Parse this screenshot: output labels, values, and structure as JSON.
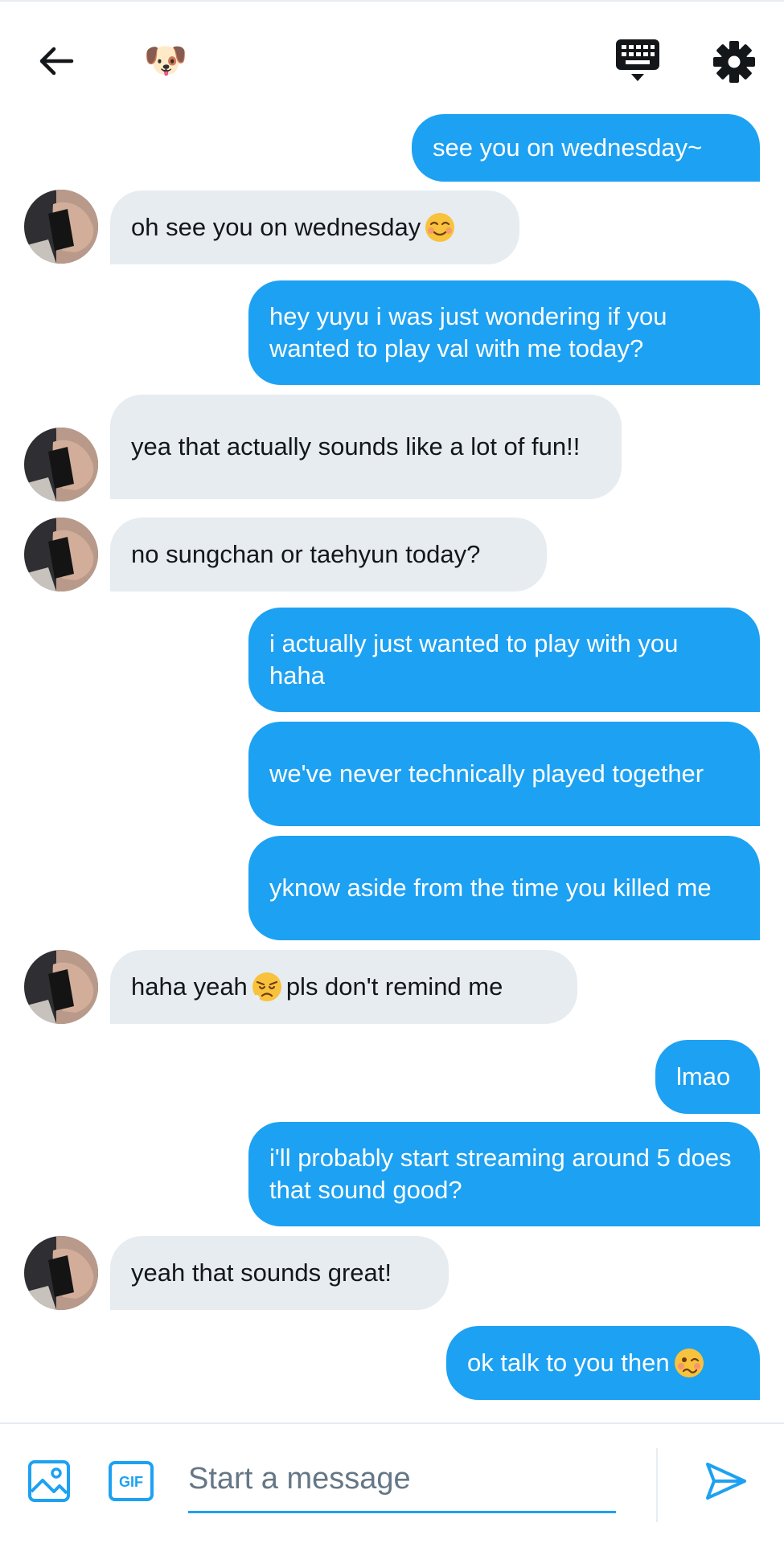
{
  "header": {
    "back_icon": "arrow-left-icon",
    "contact_avatar_emoji": "🐶",
    "keyboard_icon": "keyboard-icon",
    "settings_icon": "gear-icon"
  },
  "colors": {
    "accent": "#1da1f2",
    "received_bubble": "#e6ecf0",
    "text": "#14171a",
    "placeholder": "#657786"
  },
  "messages": [
    {
      "direction": "sent",
      "text": "see you on wednesday~"
    },
    {
      "direction": "received",
      "text": "oh see you on wednesday",
      "emoji": "smiling-face-icon"
    },
    {
      "direction": "sent",
      "text": "hey yuyu i was just wondering if you wanted to play val with me today?"
    },
    {
      "direction": "received",
      "text": "yea that actually sounds like a lot of fun!!"
    },
    {
      "direction": "received",
      "text": "no sungchan or taehyun today?"
    },
    {
      "direction": "sent",
      "text": "i actually just wanted to play with you haha"
    },
    {
      "direction": "sent",
      "text": "we've never technically played together"
    },
    {
      "direction": "sent",
      "text": "yknow aside from the time you killed me"
    },
    {
      "direction": "received",
      "text_before": "haha yeah",
      "text_after": "pls don't remind me",
      "emoji": "sad-face-icon"
    },
    {
      "direction": "sent",
      "text": "lmao"
    },
    {
      "direction": "sent",
      "text": "i'll probably start streaming around 5 does that sound good?"
    },
    {
      "direction": "received",
      "text": "yeah that sounds great!"
    },
    {
      "direction": "sent",
      "text": "ok talk to you then",
      "emoji": "woozy-face-icon"
    }
  ],
  "composer": {
    "placeholder": "Start a message",
    "value": "",
    "image_icon": "image-icon",
    "gif_label": "GIF",
    "send_icon": "send-icon"
  }
}
